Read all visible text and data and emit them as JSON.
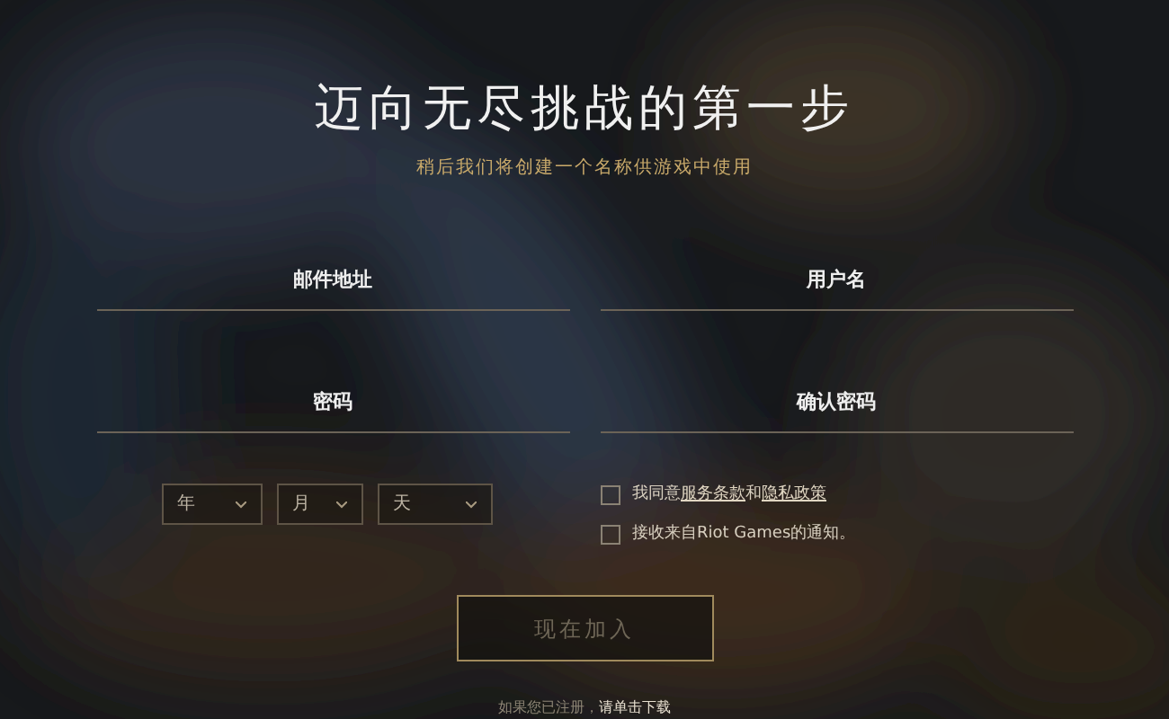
{
  "title": "迈向无尽挑战的第一步",
  "subtitle": "稍后我们将创建一个名称供游戏中使用",
  "fields": [
    {
      "placeholder": "邮件地址"
    },
    {
      "placeholder": "用户名"
    },
    {
      "placeholder": "密码"
    },
    {
      "placeholder": "确认密码"
    }
  ],
  "birth_date": [
    {
      "placeholder": "年"
    },
    {
      "placeholder": "月"
    },
    {
      "placeholder": "天"
    }
  ],
  "checkboxes": [
    {
      "checked": false,
      "parts": [
        {
          "text": "我同意",
          "link": false
        },
        {
          "text": "服务条款",
          "link": true
        },
        {
          "text": "和",
          "link": false
        },
        {
          "text": "隐私政策",
          "link": true
        }
      ]
    },
    {
      "checked": false,
      "parts": [
        {
          "text": "接收来自Riot Games的通知。",
          "link": false
        }
      ]
    }
  ],
  "submit_button": "现在加入",
  "footer": {
    "text": "如果您已注册，",
    "link": "请单击下载"
  }
}
